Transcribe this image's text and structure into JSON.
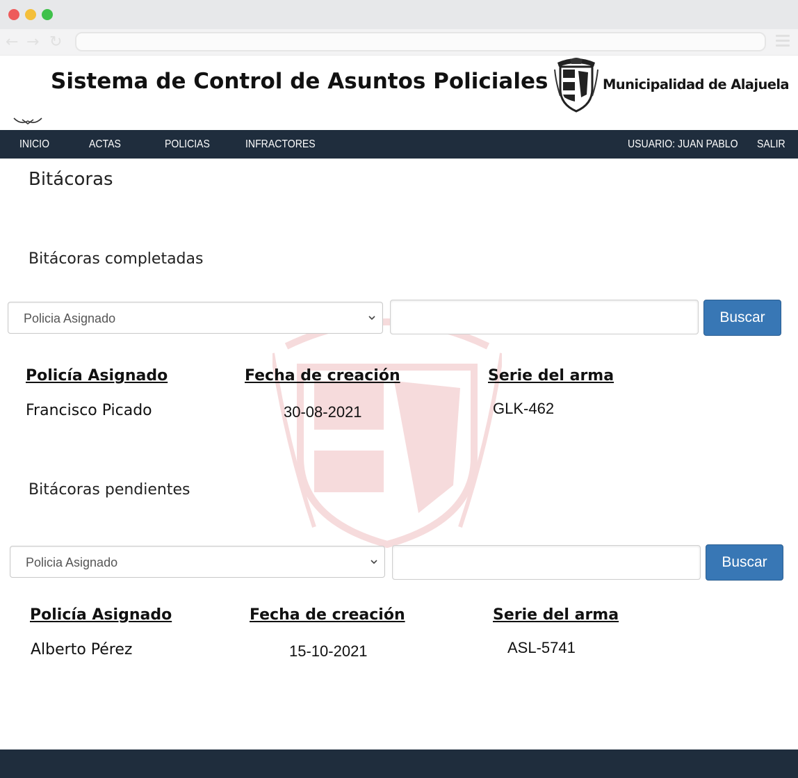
{
  "app": {
    "title": "Sistema de Control de Asuntos Policiales",
    "org_name": "Municipalidad de Alajuela"
  },
  "nav": {
    "items": [
      {
        "label": "INICIO"
      },
      {
        "label": "ACTAS"
      },
      {
        "label": "POLICIAS"
      },
      {
        "label": "INFRACTORES"
      }
    ],
    "user_label": "USUARIO: JUAN PABLO",
    "logout_label": "SALIR"
  },
  "page": {
    "title": "Bitácoras"
  },
  "completed": {
    "title": "Bitácoras completadas",
    "filter_select": "Policia Asignado",
    "search_value": "",
    "search_button": "Buscar",
    "columns": [
      "Policía Asignado",
      "Fecha de creación",
      "Serie del arma"
    ],
    "rows": [
      [
        "Francisco Picado",
        "30-08-2021",
        "GLK-462"
      ]
    ]
  },
  "pending": {
    "title": "Bitácoras pendientes",
    "filter_select": "Policia Asignado",
    "search_value": "",
    "search_button": "Buscar",
    "columns": [
      "Policía Asignado",
      "Fecha de creación",
      "Serie del arma"
    ],
    "rows": [
      [
        "Alberto Pérez",
        "15-10-2021",
        "ASL-5741"
      ]
    ]
  },
  "colors": {
    "navbar": "#1f2d3d",
    "button": "#3877b5",
    "watermark": "#c9252c"
  },
  "icons": {
    "back": "arrow-left-icon",
    "forward": "arrow-right-icon",
    "reload": "reload-icon",
    "menu": "hamburger-menu-icon",
    "select": "chevron-down-icon"
  }
}
